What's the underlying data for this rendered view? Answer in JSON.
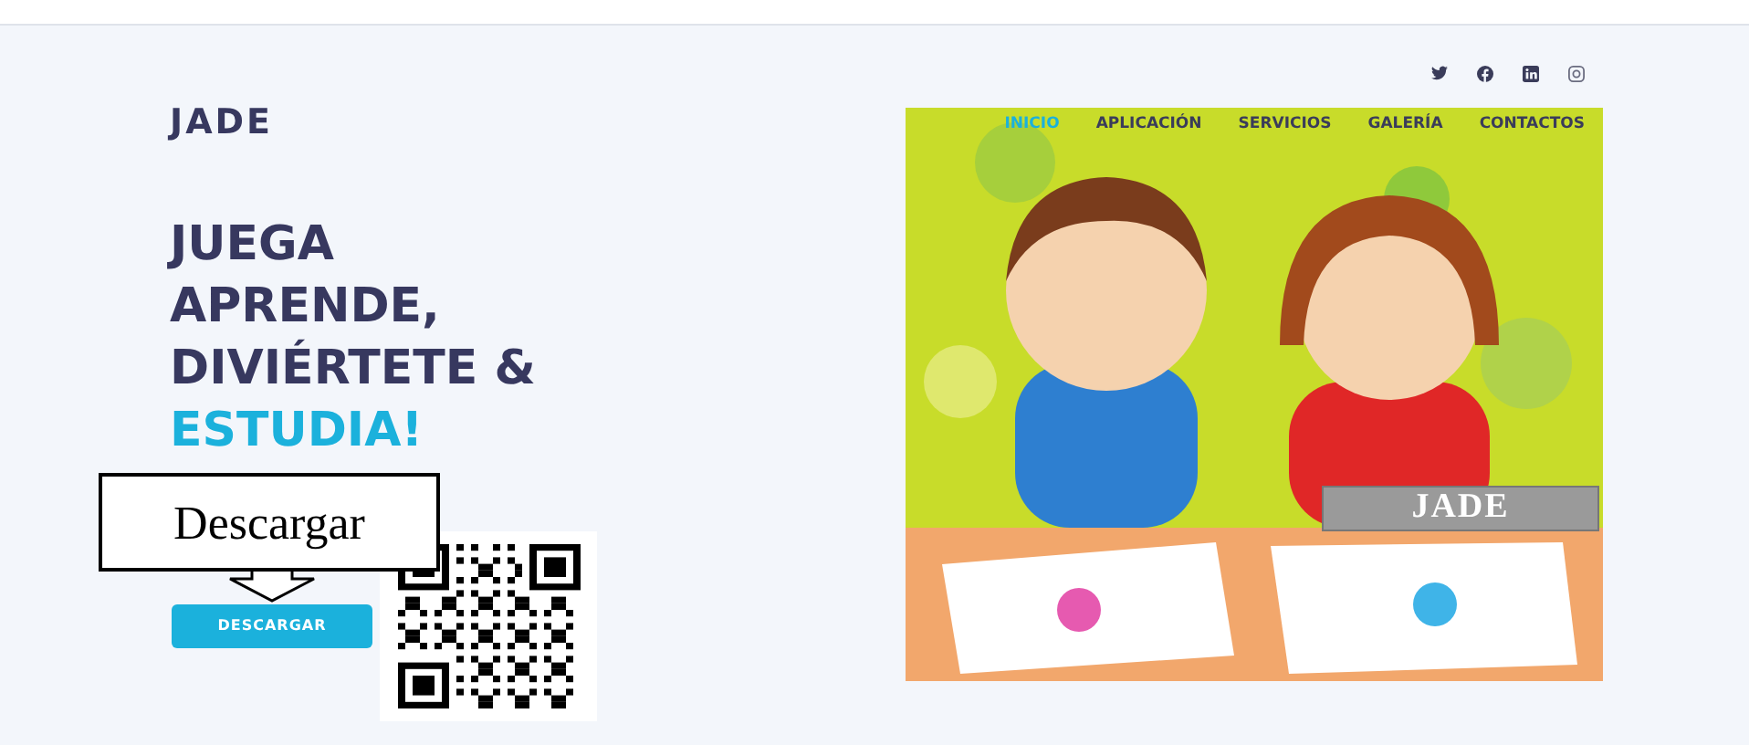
{
  "brand": "JADE",
  "nav": [
    {
      "label": "INICIO",
      "selected": true
    },
    {
      "label": "APLICACIÓN",
      "selected": false
    },
    {
      "label": "SERVICIOS",
      "selected": false
    },
    {
      "label": "GALERÍA",
      "selected": false
    },
    {
      "label": "CONTACTOS",
      "selected": false
    }
  ],
  "headline": [
    {
      "text": "JUEGA",
      "highlight": false
    },
    {
      "text": "APRENDE,",
      "highlight": false
    },
    {
      "text": "DIVIÉRTETE &",
      "highlight": false
    },
    {
      "text": "ESTUDIA!",
      "highlight": true
    }
  ],
  "callout": "Descargar",
  "download_button": "DESCARGAR",
  "image_label": "JADE"
}
